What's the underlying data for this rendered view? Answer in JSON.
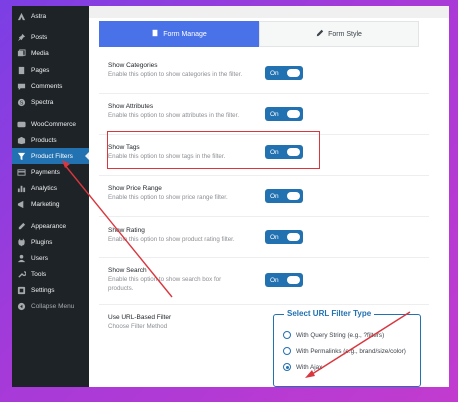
{
  "sidebar": {
    "items": [
      {
        "label": "Astra",
        "icon": "astra-icon"
      },
      {
        "label": "Posts",
        "icon": "pin-icon"
      },
      {
        "label": "Media",
        "icon": "media-icon"
      },
      {
        "label": "Pages",
        "icon": "page-icon"
      },
      {
        "label": "Comments",
        "icon": "comment-icon"
      },
      {
        "label": "Spectra",
        "icon": "spectra-icon"
      },
      {
        "label": "WooCommerce",
        "icon": "woocommerce-icon"
      },
      {
        "label": "Products",
        "icon": "products-icon"
      },
      {
        "label": "Product Filters",
        "icon": "filter-icon"
      },
      {
        "label": "Payments",
        "icon": "payments-icon"
      },
      {
        "label": "Analytics",
        "icon": "analytics-icon"
      },
      {
        "label": "Marketing",
        "icon": "marketing-icon"
      },
      {
        "label": "Appearance",
        "icon": "appearance-icon"
      },
      {
        "label": "Plugins",
        "icon": "plugins-icon"
      },
      {
        "label": "Users",
        "icon": "users-icon"
      },
      {
        "label": "Tools",
        "icon": "tools-icon"
      },
      {
        "label": "Settings",
        "icon": "settings-icon"
      },
      {
        "label": "Collapse Menu",
        "icon": "collapse-icon"
      }
    ]
  },
  "tabs": {
    "form_manage": "Form Manage",
    "form_style": "Form Style"
  },
  "options": [
    {
      "title": "Show Categories",
      "desc": "Enable this option to show categories in the filter.",
      "toggle": "On"
    },
    {
      "title": "Show Attributes",
      "desc": "Enable this option to show attributes in the filter.",
      "toggle": "On"
    },
    {
      "title": "Show Tags",
      "desc": "Enable this option to show tags in the filter.",
      "toggle": "On"
    },
    {
      "title": "Show Price Range",
      "desc": "Enable this option to show price range filter.",
      "toggle": "On"
    },
    {
      "title": "Show Rating",
      "desc": "Enable this option to show product rating filter.",
      "toggle": "On"
    },
    {
      "title": "Show Search",
      "desc": "Enable this option to show search box for products.",
      "toggle": "On"
    }
  ],
  "url_filter": {
    "title": "Use URL-Based Filter",
    "desc": "Choose Filter Method",
    "box_title": "Select URL Filter Type",
    "options": [
      {
        "label": "With Query String (e.g., ?filters)",
        "checked": false
      },
      {
        "label": "With Permalinks (e.g., brand/size/color)",
        "checked": false
      },
      {
        "label": "With Ajax",
        "checked": true
      }
    ]
  },
  "colors": {
    "accent": "#2271b1",
    "tab_active": "#4a72e8",
    "highlight": "#d9363e",
    "sidebar_bg": "#1d2327"
  }
}
